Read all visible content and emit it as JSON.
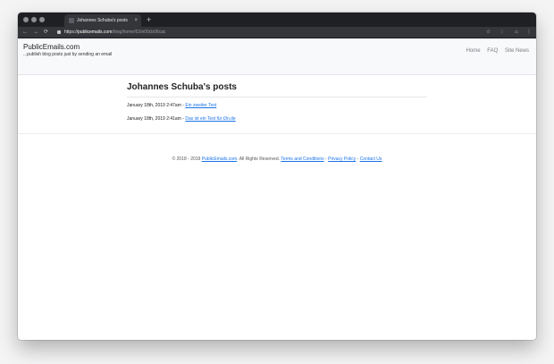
{
  "browser": {
    "tab_title": "Johannes Schuba's posts",
    "tab_close": "×",
    "new_tab": "+",
    "nav": {
      "back": "←",
      "forward": "→",
      "reload": "⟳"
    },
    "url": {
      "scheme": "https://",
      "host": "publicemails.com",
      "path": "/blog/home/63/e00cb06cac"
    },
    "icons": {
      "bookmark": "☆",
      "extension": "◌",
      "profile": "⌂",
      "menu": "⋮"
    }
  },
  "site": {
    "brand": "PublicEmails.com",
    "tagline": "...publish blog posts just by sending an email",
    "nav": [
      {
        "label": "Home"
      },
      {
        "label": "FAQ"
      },
      {
        "label": "Site News"
      }
    ]
  },
  "main": {
    "title": "Johannes Schuba's posts",
    "posts": [
      {
        "date": "January 18th, 2019 2:47am",
        "separator": " - ",
        "link": "Ein zweiter Test"
      },
      {
        "date": "January 18th, 2019 2:41am",
        "separator": " - ",
        "link": "Das ist ein Test für t3n.de"
      }
    ]
  },
  "footer": {
    "prefix": "© 2018 - 2019 ",
    "site_link": "PublicEmails.com",
    "rights": ". All Rights Reserved. ",
    "terms": "Terms and Conditions",
    "sep": " - ",
    "privacy": "Privacy Policy",
    "contact": "Contact Us"
  }
}
